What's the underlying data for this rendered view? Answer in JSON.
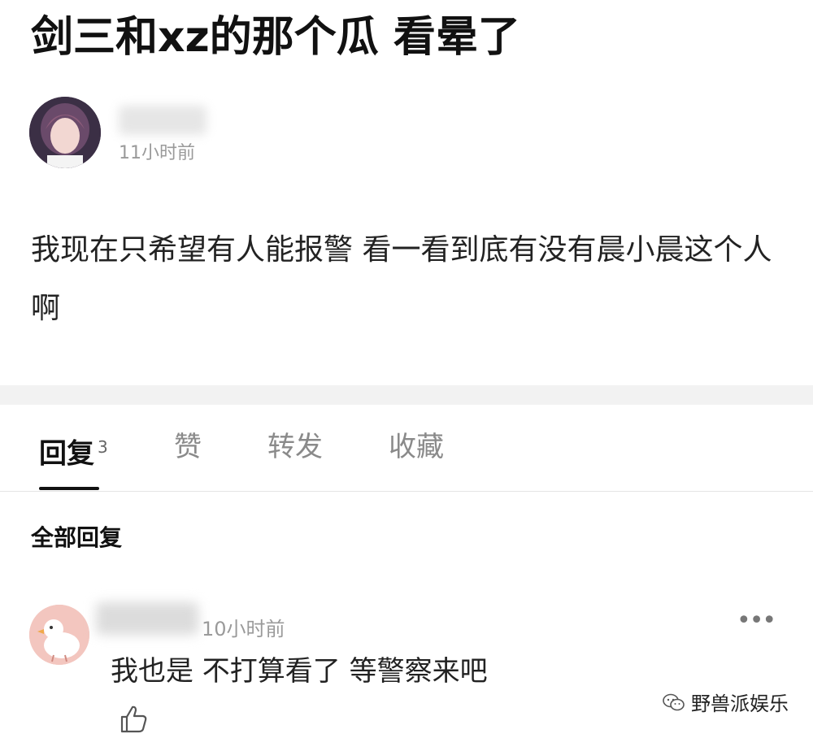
{
  "post": {
    "title": "剑三和xz的那个瓜 看晕了",
    "time": "11小时前",
    "body": "我现在只希望有人能报警 看一看到底有没有晨小晨这个人啊"
  },
  "tabs": {
    "replies_label": "回复",
    "replies_count": "3",
    "likes_label": "赞",
    "forward_label": "转发",
    "collect_label": "收藏"
  },
  "replies": {
    "heading": "全部回复",
    "items": [
      {
        "time": "10小时前",
        "more": "•••",
        "text": "我也是 不打算看了 等警察来吧"
      }
    ]
  },
  "watermark": {
    "text": "野兽派娱乐"
  },
  "icons": {
    "author_avatar": "avatar-icon",
    "comment_avatar": "duck-avatar-icon",
    "like": "thumbs-up-icon",
    "more": "more-dots-icon",
    "watermark_logo": "wechat-logo-icon"
  },
  "colors": {
    "background": "#ffffff",
    "muted_text": "#9a9a9a",
    "divider": "#f2f2f2"
  }
}
